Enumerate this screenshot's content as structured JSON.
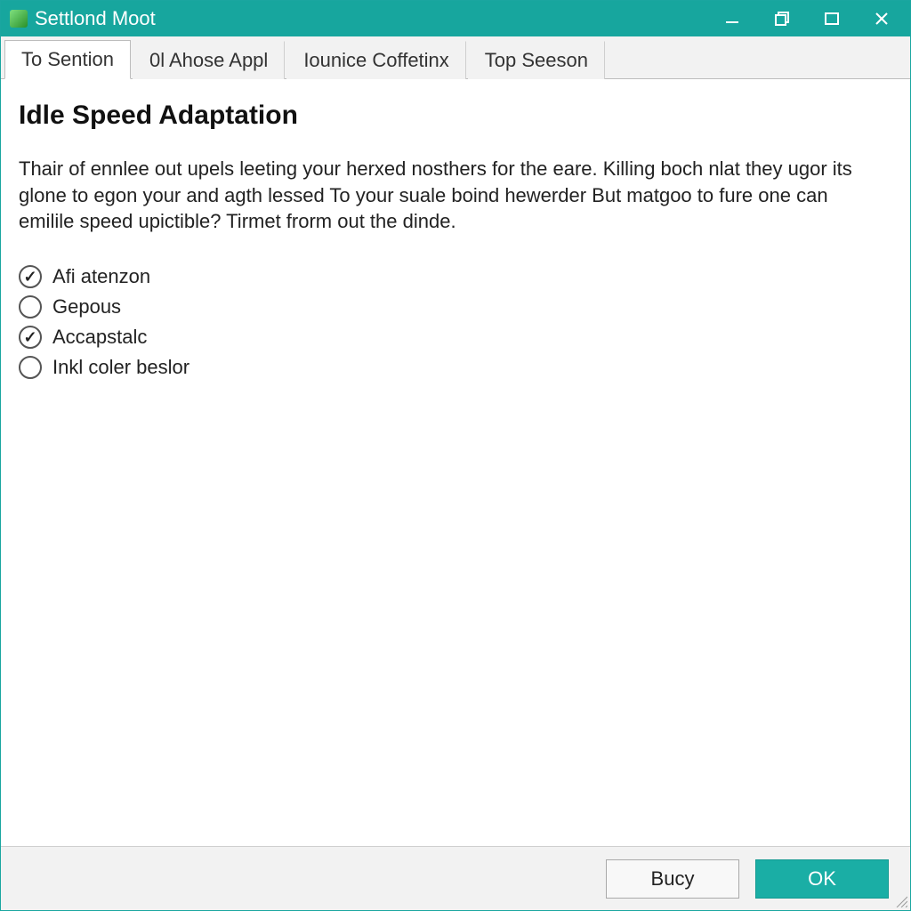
{
  "titlebar": {
    "title": "Settlond Moot"
  },
  "tabs": [
    {
      "label": "To Sention",
      "active": true
    },
    {
      "label": "0l Ahose Appl",
      "active": false
    },
    {
      "label": "Iounice Coffetinx",
      "active": false
    },
    {
      "label": "Top Seeson",
      "active": false
    }
  ],
  "main": {
    "heading": "Idle Speed Adaptation",
    "description": "Thair of ennlee out upels leeting your herxed nosthers for the eare. Killing boch nlat they ugor its glone to egon your and agth lessed To your suale boind hewerder But matgoo to fure one can emilile speed upictible? Tirmet frorm out the dinde."
  },
  "options": [
    {
      "label": "Afi atenzon",
      "checked": true
    },
    {
      "label": "Gepous",
      "checked": false
    },
    {
      "label": "Accapstalc",
      "checked": true
    },
    {
      "label": "Inkl coler beslor",
      "checked": false
    }
  ],
  "footer": {
    "secondary_label": "Bucy",
    "primary_label": "OK"
  }
}
